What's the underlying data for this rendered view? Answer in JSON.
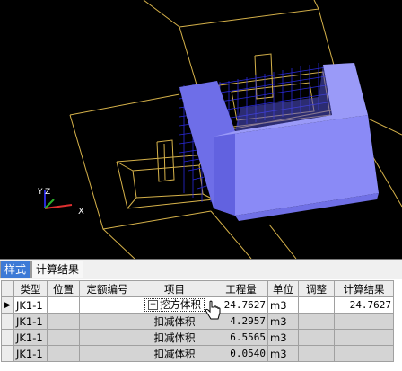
{
  "viewport": {
    "axis_labels": {
      "x": "X",
      "y": "Y",
      "z": "Z"
    },
    "colors": {
      "background": "#000000",
      "wireframe": "#d6b24a",
      "solid": "#7c7cf4",
      "mesh": "#2a2ad8"
    }
  },
  "tabs": [
    {
      "label": "样式",
      "active": true
    },
    {
      "label": "计算结果",
      "active": false
    }
  ],
  "table": {
    "headers": [
      "类型",
      "位置",
      "定额编号",
      "项目",
      "工程量",
      "单位",
      "调整",
      "计算结果"
    ],
    "rows": [
      {
        "type": "JK1-1",
        "position": "",
        "quota": "",
        "item": "挖方体积",
        "quantity": "24.7627",
        "unit": "m3",
        "adjust": "",
        "result": "24.7627",
        "selected": true
      },
      {
        "type": "JK1-1",
        "position": "",
        "quota": "",
        "item": "扣减体积",
        "quantity": "4.2957",
        "unit": "m3",
        "adjust": "",
        "result": ""
      },
      {
        "type": "JK1-1",
        "position": "",
        "quota": "",
        "item": "扣减体积",
        "quantity": "6.5565",
        "unit": "m3",
        "adjust": "",
        "result": ""
      },
      {
        "type": "JK1-1",
        "position": "",
        "quota": "",
        "item": "扣减体积",
        "quantity": "0.0540",
        "unit": "m3",
        "adjust": "",
        "result": ""
      }
    ]
  }
}
